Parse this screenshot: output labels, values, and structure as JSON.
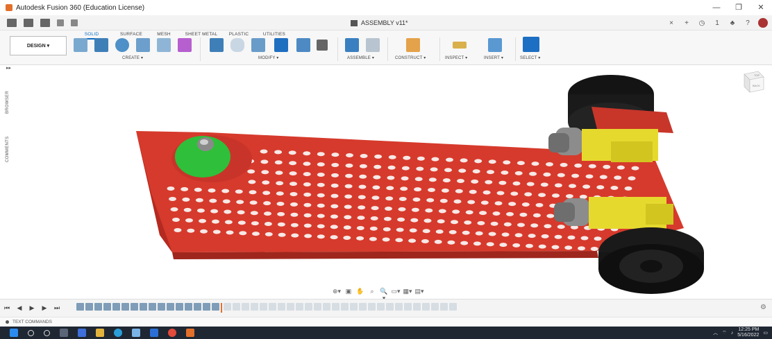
{
  "window": {
    "title": "Autodesk Fusion 360 (Education License)",
    "controls": [
      "—",
      "❐",
      "✕"
    ]
  },
  "document": {
    "title": "ASSEMBLY v11*"
  },
  "qat_right": {
    "close_tab": "×",
    "add_tab": "+",
    "job_status": "◷",
    "user_count": "1",
    "notify": "♣",
    "help": "?"
  },
  "workspace": {
    "label": "DESIGN ▾"
  },
  "tabs": [
    "SOLID",
    "SURFACE",
    "MESH",
    "SHEET METAL",
    "PLASTIC",
    "UTILITIES"
  ],
  "groups": [
    "CREATE ▾",
    "MODIFY ▾",
    "ASSEMBLE ▾",
    "CONSTRUCT ▾",
    "INSPECT ▾",
    "INSERT ▾",
    "SELECT ▾"
  ],
  "side": {
    "browser": "BROWSER",
    "comments": "COMMENTS",
    "expand": "▸▸"
  },
  "viewcube": {
    "front": "BACK",
    "top": "TOP"
  },
  "navbar": [
    "⊕▾",
    "▣",
    "✋",
    "⌕",
    "🔍▾",
    "▭▾",
    "▦▾",
    "▤▾"
  ],
  "timeline": {
    "controls": [
      "⏮",
      "◀",
      "▶",
      "▶",
      "⏭"
    ],
    "items_done": 16,
    "items_pending": 26
  },
  "text_commands": "TEXT COMMANDS",
  "taskbar": {
    "time": "12:25 PM",
    "date": "5/16/2022"
  },
  "colors": {
    "plate": "#d63a2c",
    "motor": "#e6d92e",
    "wheel": "#1a1a1a",
    "caster": "#2fbf3a",
    "accent": "#0a6cc4"
  }
}
